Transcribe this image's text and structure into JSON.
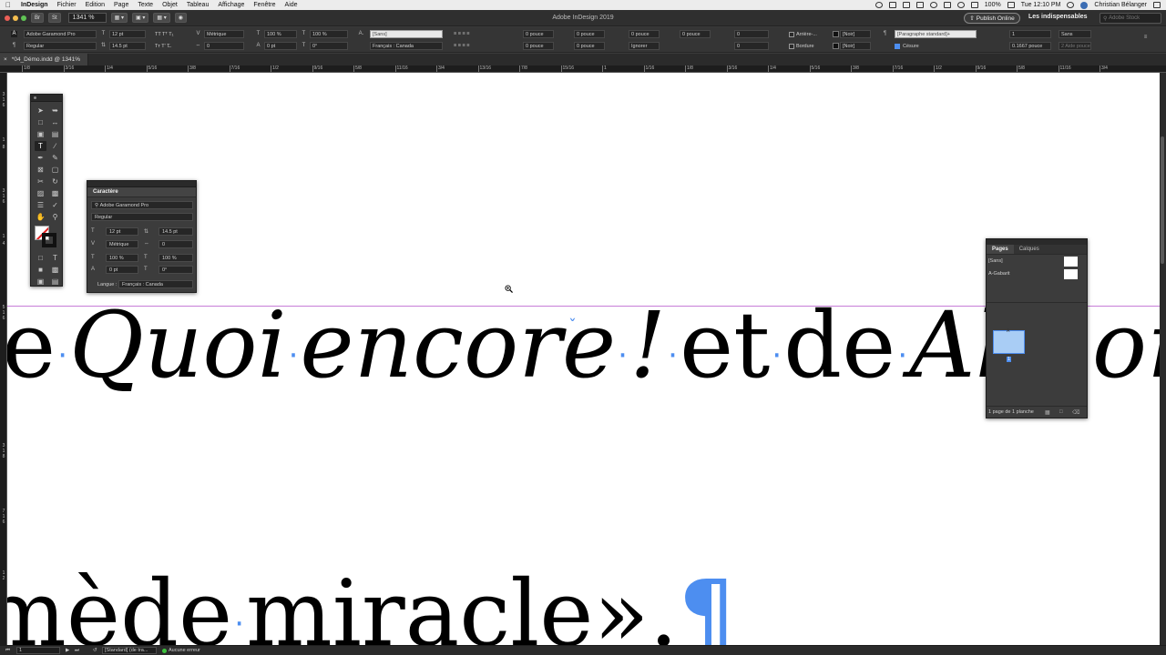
{
  "menubar": {
    "app": "InDesign",
    "items": [
      "Fichier",
      "Edition",
      "Page",
      "Texte",
      "Objet",
      "Tableau",
      "Affichage",
      "Fenêtre",
      "Aide"
    ],
    "battery": "100%",
    "clock": "Tue 12:10 PM",
    "user": "Christian Bélanger"
  },
  "appbar": {
    "zoom": "1341 %",
    "title": "Adobe InDesign 2019",
    "publish": "Publish Online",
    "workspace": "Les indispensables",
    "search_placeholder": "Adobe Stock"
  },
  "control": {
    "font_family": "Adobe Garamond Pro",
    "font_style": "Regular",
    "size": "12 pt",
    "leading": "14.5 pt",
    "kerning": "Métrique",
    "tracking": "0",
    "vscale": "100 %",
    "hscale": "100 %",
    "baseline": "0 pt",
    "skew": "0°",
    "char_style": "[Sans]",
    "language": "Français : Canada",
    "indent_1": "0 pouce",
    "indent_2": "0 pouce",
    "indent_3": "0 pouce",
    "indent_4": "0 pouce",
    "indent_5": "0 pouce",
    "indent_6": "0 pouce",
    "ignore": "Ignorer",
    "drop_1": "0",
    "drop_2": "0",
    "shading_label": "Arrière-...",
    "border_label": "Bordure",
    "swatch_1": "[Noir]",
    "swatch_2": "[Noir]",
    "para_style": "[Paragraphe standard]+",
    "hyphen_label": "Césure",
    "columns": "1",
    "col_style": "Sans",
    "gutter": "0.1667 pouce",
    "span": "2 Aide pouce"
  },
  "doc": {
    "tab": "*04_Démo.indd @ 1341%"
  },
  "ruler": {
    "h": [
      "1/8",
      "3/16",
      "1/4",
      "5/16",
      "3/8",
      "7/16",
      "1/2",
      "9/16",
      "5/8",
      "11/16",
      "3/4",
      "13/16",
      "7/8",
      "15/16",
      "1",
      "1/16",
      "1/8",
      "3/16",
      "1/4",
      "5/16",
      "3/8",
      "7/16",
      "1/2",
      "9/16",
      "5/8",
      "11/16",
      "3/4"
    ],
    "v": [
      "3",
      "1",
      "6",
      "1",
      "8",
      "3",
      "1",
      "6",
      "1",
      "4",
      "5",
      "1",
      "6",
      "3",
      "1",
      "8",
      "7",
      "1",
      "6",
      "1",
      "2"
    ]
  },
  "canvas": {
    "line1": {
      "w1": "e",
      "w2": "Quoi",
      "w3": "encore",
      "w4": "!",
      "w5": "et",
      "w6": "de",
      "w7": "Ah",
      "w8": "bon"
    },
    "line2": {
      "w1": "mède",
      "w2": "miracle».",
      "pilcrow": "¶"
    },
    "dot": "·"
  },
  "character_panel": {
    "title": "Caractère",
    "font_family": "Adobe Garamond Pro",
    "font_style": "Regular",
    "size": "12 pt",
    "leading": "14.5 pt",
    "kerning": "Métrique",
    "tracking": "0",
    "vscale": "100 %",
    "hscale": "100 %",
    "baseline": "0 pt",
    "skew": "0°",
    "language_label": "Langue :",
    "language": "Français : Canada"
  },
  "pages_panel": {
    "tabs": [
      "Pages",
      "Calques"
    ],
    "masters": [
      "[Sans]",
      "A-Gabarit"
    ],
    "page_thumb_prefix": "A",
    "page_number": "1",
    "footer": "1 page de 1 planche"
  },
  "statusbar": {
    "page": "1",
    "style": "[Standard] (de tra...",
    "errors": "Aucune erreur"
  }
}
